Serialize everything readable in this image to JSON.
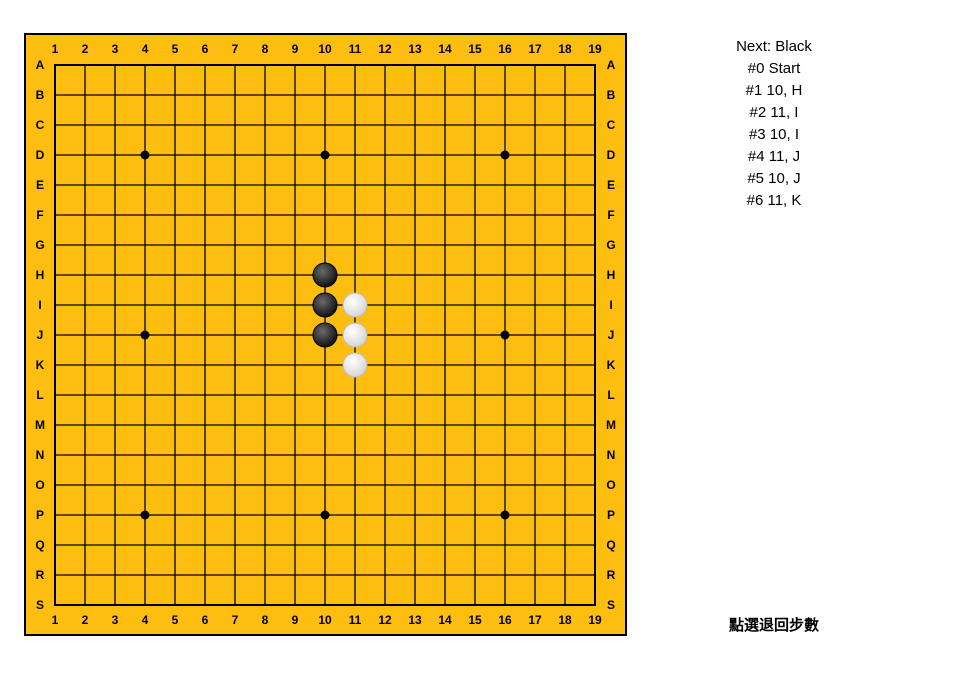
{
  "board": {
    "size": 19,
    "col_labels": [
      "1",
      "2",
      "3",
      "4",
      "5",
      "6",
      "7",
      "8",
      "9",
      "10",
      "11",
      "12",
      "13",
      "14",
      "15",
      "16",
      "17",
      "18",
      "19"
    ],
    "row_labels": [
      "A",
      "B",
      "C",
      "D",
      "E",
      "F",
      "G",
      "H",
      "I",
      "J",
      "K",
      "L",
      "M",
      "N",
      "O",
      "P",
      "Q",
      "R",
      "S"
    ],
    "star_points": [
      [
        4,
        "D"
      ],
      [
        10,
        "D"
      ],
      [
        16,
        "D"
      ],
      [
        4,
        "J"
      ],
      [
        16,
        "J"
      ],
      [
        4,
        "P"
      ],
      [
        10,
        "P"
      ],
      [
        16,
        "P"
      ]
    ],
    "stones": [
      {
        "col": 10,
        "row": "H",
        "color": "black"
      },
      {
        "col": 11,
        "row": "I",
        "color": "white"
      },
      {
        "col": 10,
        "row": "I",
        "color": "black"
      },
      {
        "col": 11,
        "row": "J",
        "color": "white"
      },
      {
        "col": 10,
        "row": "J",
        "color": "black"
      },
      {
        "col": 11,
        "row": "K",
        "color": "white"
      }
    ],
    "colors": {
      "wood": "#FEBE10",
      "line": "#000000",
      "border": "#000000"
    }
  },
  "status": {
    "next": "Next: Black"
  },
  "moves": [
    "#0 Start",
    "#1 10, H",
    "#2 11, I",
    "#3 10, I",
    "#4 11, J",
    "#5 10, J",
    "#6 11, K"
  ],
  "hint": "點選退回步數"
}
